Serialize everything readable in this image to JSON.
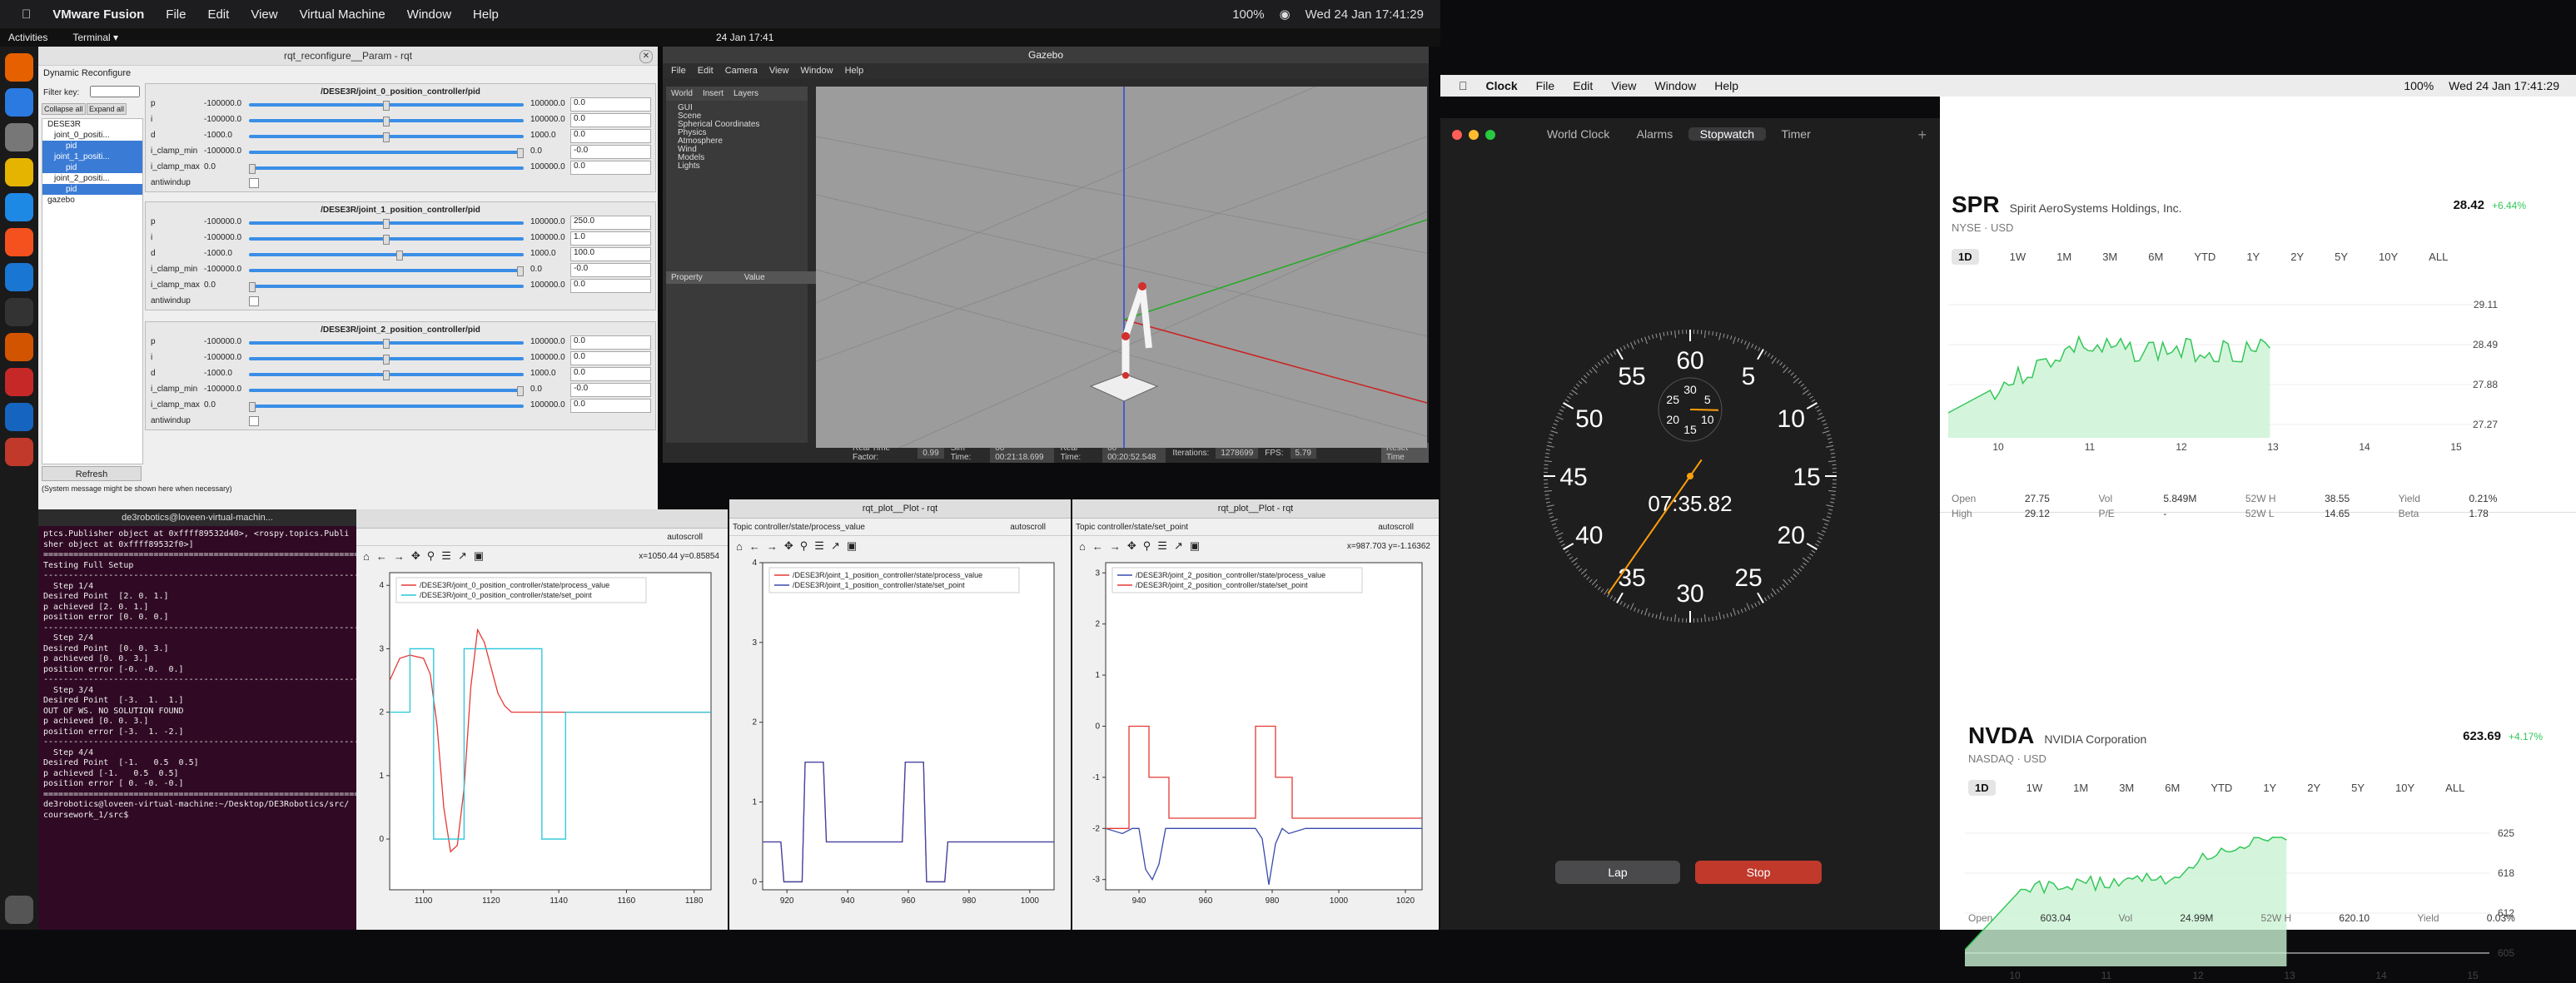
{
  "mac_bar": {
    "app": "VMware Fusion",
    "menus": [
      "File",
      "Edit",
      "View",
      "Virtual Machine",
      "Window",
      "Help"
    ],
    "battery": "100%",
    "datetime": "Wed 24 Jan  17:41:29"
  },
  "ubuntu_bar": {
    "activities": "Activities",
    "terminal": "Terminal ▾",
    "clock": "24 Jan  17:41"
  },
  "rqt": {
    "title": "rqt_reconfigure__Param - rqt",
    "plugin": "Dynamic Reconfigure",
    "filter_label": "Filter key:",
    "collapse_all": "Collapse all",
    "expand_all": "Expand all",
    "refresh": "Refresh",
    "system_message": "(System message might be shown here when necessary)",
    "tree": [
      {
        "label": "DESE3R",
        "selected": false
      },
      {
        "label": "joint_0_positi...",
        "selected": false
      },
      {
        "label": "pid",
        "selected": true
      },
      {
        "label": "joint_1_positi...",
        "selected": true
      },
      {
        "label": "pid",
        "selected": true
      },
      {
        "label": "joint_2_positi...",
        "selected": false
      },
      {
        "label": "pid",
        "selected": true
      },
      {
        "label": "gazebo",
        "selected": false
      }
    ],
    "panels": [
      {
        "title": "/DESE3R/joint_0_position_controller/pid",
        "rows": [
          {
            "name": "p",
            "min": "-100000.0",
            "max": "100000.0",
            "value": "0.0",
            "fill": 0.5
          },
          {
            "name": "i",
            "min": "-100000.0",
            "max": "100000.0",
            "value": "0.0",
            "fill": 0.5
          },
          {
            "name": "d",
            "min": "-1000.0",
            "max": "1000.0",
            "value": "0.0",
            "fill": 0.5
          },
          {
            "name": "i_clamp_min",
            "min": "-100000.0",
            "max": "0.0",
            "value": "-0.0",
            "fill": 1.0
          },
          {
            "name": "i_clamp_max",
            "min": "0.0",
            "max": "100000.0",
            "value": "0.0",
            "fill": 0.0
          },
          {
            "name": "antiwindup",
            "min": "",
            "max": "",
            "value": "",
            "fill": 0
          }
        ]
      },
      {
        "title": "/DESE3R/joint_1_position_controller/pid",
        "rows": [
          {
            "name": "p",
            "min": "-100000.0",
            "max": "100000.0",
            "value": "250.0",
            "fill": 0.5
          },
          {
            "name": "i",
            "min": "-100000.0",
            "max": "100000.0",
            "value": "1.0",
            "fill": 0.5
          },
          {
            "name": "d",
            "min": "-1000.0",
            "max": "1000.0",
            "value": "100.0",
            "fill": 0.55
          },
          {
            "name": "i_clamp_min",
            "min": "-100000.0",
            "max": "0.0",
            "value": "-0.0",
            "fill": 1.0
          },
          {
            "name": "i_clamp_max",
            "min": "0.0",
            "max": "100000.0",
            "value": "0.0",
            "fill": 0.0
          },
          {
            "name": "antiwindup",
            "min": "",
            "max": "",
            "value": "",
            "fill": 0
          }
        ]
      },
      {
        "title": "/DESE3R/joint_2_position_controller/pid",
        "rows": [
          {
            "name": "p",
            "min": "-100000.0",
            "max": "100000.0",
            "value": "0.0",
            "fill": 0.5
          },
          {
            "name": "i",
            "min": "-100000.0",
            "max": "100000.0",
            "value": "0.0",
            "fill": 0.5
          },
          {
            "name": "d",
            "min": "-1000.0",
            "max": "1000.0",
            "value": "0.0",
            "fill": 0.5
          },
          {
            "name": "i_clamp_min",
            "min": "-100000.0",
            "max": "0.0",
            "value": "-0.0",
            "fill": 1.0
          },
          {
            "name": "i_clamp_max",
            "min": "0.0",
            "max": "100000.0",
            "value": "0.0",
            "fill": 0.0
          },
          {
            "name": "antiwindup",
            "min": "",
            "max": "",
            "value": "",
            "fill": 0
          }
        ]
      }
    ]
  },
  "gazebo": {
    "title": "Gazebo",
    "menus": [
      "File",
      "Edit",
      "Camera",
      "View",
      "Window",
      "Help"
    ],
    "tabs": [
      "World",
      "Insert",
      "Layers"
    ],
    "world_items": [
      "GUI",
      "Scene",
      "Spherical Coordinates",
      "Physics",
      "Atmosphere",
      "Wind",
      "Models",
      "Lights"
    ],
    "property_header": [
      "Property",
      "Value"
    ],
    "status": {
      "real_time_factor_label": "Real Time Factor:",
      "real_time_factor": "0.99",
      "sim_time_label": "Sim Time:",
      "sim_time": "00 00:21:18.699",
      "real_time_label": "Real Time:",
      "real_time": "00 00:20:52.548",
      "iterations_label": "Iterations:",
      "iterations": "1278699",
      "fps_label": "FPS:",
      "fps": "5.79",
      "reset": "Reset Time"
    }
  },
  "plots": [
    {
      "title": "",
      "topic": "",
      "autoscroll": "autoscroll",
      "coords": "x=1050.44    y=0.85854",
      "legend": [
        "/DESE3R/joint_0_position_controller/state/process_value",
        "/DESE3R/joint_0_position_controller/state/set_point"
      ]
    },
    {
      "title": "rqt_plot__Plot - rqt",
      "topic": "Topic controller/state/process_value",
      "autoscroll": "autoscroll",
      "coords": "",
      "legend": [
        "/DESE3R/joint_1_position_controller/state/process_value",
        "/DESE3R/joint_1_position_controller/state/set_point"
      ]
    },
    {
      "title": "rqt_plot__Plot - rqt",
      "topic": "Topic controller/state/set_point",
      "autoscroll": "autoscroll",
      "coords": "x=987.703    y=-1.16362",
      "legend": [
        "/DESE3R/joint_2_position_controller/state/process_value",
        "/DESE3R/joint_2_position_controller/state/set_point"
      ]
    }
  ],
  "chart_data": [
    {
      "type": "line",
      "title": "",
      "xlabel": "",
      "ylabel": "",
      "xlim": [
        1090,
        1185
      ],
      "ylim": [
        -0.8,
        4.2
      ],
      "xticks": [
        1100,
        1120,
        1140,
        1160,
        1180
      ],
      "yticks": [
        0,
        1,
        2,
        3,
        4
      ],
      "series": [
        {
          "name": "/DESE3R/joint_0_position_controller/state/process_value",
          "color": "#e53935",
          "x": [
            1090,
            1093,
            1096,
            1100,
            1102,
            1104,
            1106,
            1108,
            1110,
            1112,
            1114,
            1116,
            1118,
            1120,
            1122,
            1124,
            1126,
            1130,
            1135,
            1140,
            1185
          ],
          "y": [
            2.5,
            2.85,
            2.9,
            2.85,
            2.6,
            1.8,
            0.5,
            -0.2,
            -0.1,
            0.8,
            2.4,
            3.3,
            3.1,
            2.7,
            2.3,
            2.1,
            2.0,
            2.0,
            2.0,
            2.0,
            2.0
          ]
        },
        {
          "name": "/DESE3R/joint_0_position_controller/state/set_point",
          "color": "#26c6da",
          "x": [
            1090,
            1096,
            1096,
            1103,
            1103,
            1112,
            1112,
            1135,
            1135,
            1142,
            1142,
            1185
          ],
          "y": [
            2.0,
            2.0,
            3.0,
            3.0,
            0.0,
            0.0,
            3.0,
            3.0,
            0.0,
            0.0,
            2.0,
            2.0
          ]
        }
      ]
    },
    {
      "type": "line",
      "title": "",
      "xlabel": "",
      "ylabel": "",
      "xlim": [
        912,
        1008
      ],
      "ylim": [
        -0.1,
        4.0
      ],
      "xticks": [
        920,
        940,
        960,
        980,
        1000
      ],
      "yticks": [
        0,
        1,
        2,
        3,
        4
      ],
      "series": [
        {
          "name": "/DESE3R/joint_1_position_controller/state/process_value",
          "color": "#e53935",
          "x": [
            912,
            918,
            919,
            925,
            926,
            932,
            933,
            958,
            959,
            965,
            966,
            972,
            973,
            1008
          ],
          "y": [
            0.5,
            0.5,
            0.0,
            0.0,
            1.5,
            1.5,
            0.5,
            0.5,
            1.5,
            1.5,
            0.0,
            0.0,
            0.5,
            0.5
          ]
        },
        {
          "name": "/DESE3R/joint_1_position_controller/state/set_point",
          "color": "#3949ab",
          "x": [
            912,
            918,
            919,
            925,
            926,
            932,
            933,
            958,
            959,
            965,
            966,
            972,
            973,
            1008
          ],
          "y": [
            0.5,
            0.5,
            0.0,
            0.0,
            1.5,
            1.5,
            0.5,
            0.5,
            1.5,
            1.5,
            0.0,
            0.0,
            0.5,
            0.5
          ]
        }
      ]
    },
    {
      "type": "line",
      "title": "",
      "xlabel": "",
      "ylabel": "",
      "xlim": [
        930,
        1025
      ],
      "ylim": [
        -3.2,
        3.2
      ],
      "xticks": [
        940,
        960,
        980,
        1000,
        1020
      ],
      "yticks": [
        -3,
        -2,
        -1,
        0,
        1,
        2,
        3
      ],
      "series": [
        {
          "name": "/DESE3R/joint_2_position_controller/state/process_value",
          "color": "#3949ab",
          "x": [
            930,
            935,
            938,
            940,
            942,
            944,
            946,
            948,
            950,
            975,
            977,
            979,
            981,
            983,
            985,
            990,
            1000,
            1025
          ],
          "y": [
            -2.0,
            -2.1,
            -2.0,
            -2.0,
            -2.8,
            -3.0,
            -2.7,
            -2.0,
            -2.0,
            -2.0,
            -2.2,
            -3.1,
            -2.3,
            -2.0,
            -2.1,
            -2.0,
            -2.0,
            -2.0
          ]
        },
        {
          "name": "/DESE3R/joint_2_position_controller/state/set_point",
          "color": "#e53935",
          "x": [
            930,
            937,
            937,
            943,
            943,
            949,
            949,
            975,
            975,
            981,
            981,
            986,
            986,
            1025
          ],
          "y": [
            -2.0,
            -2.0,
            0.0,
            0.0,
            -1.0,
            -1.0,
            -1.8,
            -1.8,
            0.0,
            0.0,
            -1.0,
            -1.0,
            -1.8,
            -1.8
          ]
        }
      ]
    }
  ],
  "terminal": {
    "title": "de3robotics@loveen-virtual-machin...",
    "lines": [
      "ptcs.Publisher object at 0xffff89532d40>, <rospy.topics.Publi",
      "sher object at 0xffff89532f0>]",
      "==================================================================",
      "Testing Full Setup",
      "------------------------------------------------------------------",
      "  Step 1/4",
      "Desired Point  [2. 0. 1.]",
      "p achieved [2. 0. 1.]",
      "position error [0. 0. 0.]",
      "------------------------------------------------------------------",
      "  Step 2/4",
      "Desired Point  [0. 0. 3.]",
      "p achieved [0. 0. 3.]",
      "position error [-0. -0.  0.]",
      "------------------------------------------------------------------",
      "  Step 3/4",
      "Desired Point  [-3.  1.  1.]",
      "OUT OF WS. NO SOLUTION FOUND",
      "p achieved [0. 0. 3.]",
      "position error [-3.  1. -2.]",
      "------------------------------------------------------------------",
      "  Step 4/4",
      "Desired Point  [-1.   0.5  0.5]",
      "p achieved [-1.   0.5  0.5]",
      "position error [ 0. -0. -0.]",
      "==================================================================",
      "de3robotics@loveen-virtual-machine:~/Desktop/DE3Robotics/src/",
      "coursework_1/src$ "
    ]
  },
  "mac_right": {
    "app": "Clock",
    "menus": [
      "File",
      "Edit",
      "View",
      "Window",
      "Help"
    ],
    "battery": "100%",
    "datetime": "Wed 24 Jan  17:41:29"
  },
  "clock": {
    "tabs": [
      "World Clock",
      "Alarms",
      "Stopwatch",
      "Timer"
    ],
    "active_tab": "Stopwatch",
    "time": "07:35.82",
    "dial_numbers": [
      "60",
      "5",
      "10",
      "15",
      "20",
      "25",
      "30",
      "35",
      "40",
      "45",
      "50",
      "55"
    ],
    "sub_numbers": [
      "30",
      "5",
      "10",
      "15",
      "20",
      "25"
    ],
    "lap": "Lap",
    "stop": "Stop",
    "seconds_value": 35.82,
    "minutes_value": 7.6
  },
  "stocks": [
    {
      "symbol": "SPR",
      "name": "Spirit AeroSystems Holdings, Inc.",
      "exchange": "NYSE · USD",
      "price": "28.42",
      "change": "+6.44%",
      "ranges": [
        "1D",
        "1W",
        "1M",
        "3M",
        "6M",
        "YTD",
        "1Y",
        "2Y",
        "5Y",
        "10Y",
        "ALL"
      ],
      "y_ticks": [
        "29.11",
        "28.49",
        "27.88",
        "27.27"
      ],
      "x_ticks": [
        "10",
        "11",
        "12",
        "13",
        "14",
        "15"
      ],
      "stats": [
        [
          "Open",
          "27.75"
        ],
        [
          "Vol",
          "5.849M"
        ],
        [
          "52W H",
          "38.55"
        ],
        [
          "Yield",
          "0.21%"
        ],
        [
          "High",
          "29.12"
        ],
        [
          "P/E",
          "-"
        ],
        [
          "52W L",
          "14.65"
        ],
        [
          "Beta",
          "1.78"
        ]
      ]
    },
    {
      "symbol": "NVDA",
      "name": "NVIDIA Corporation",
      "exchange": "NASDAQ · USD",
      "price": "623.69",
      "change": "+4.17%",
      "ranges": [
        "1D",
        "1W",
        "1M",
        "3M",
        "6M",
        "YTD",
        "1Y",
        "2Y",
        "5Y",
        "10Y",
        "ALL"
      ],
      "y_ticks": [
        "625",
        "618",
        "612",
        "605"
      ],
      "x_ticks": [
        "10",
        "11",
        "12",
        "13",
        "14",
        "15"
      ],
      "stats": [
        [
          "Open",
          "603.04"
        ],
        [
          "Vol",
          "24.99M"
        ],
        [
          "52W H",
          "620.10"
        ],
        [
          "Yield",
          "0.03%"
        ]
      ]
    }
  ],
  "colors": {
    "accent": "#3a8ee6",
    "stop": "#c0392b",
    "stock_up": "#34c759",
    "terminal_bg": "#300a24"
  }
}
